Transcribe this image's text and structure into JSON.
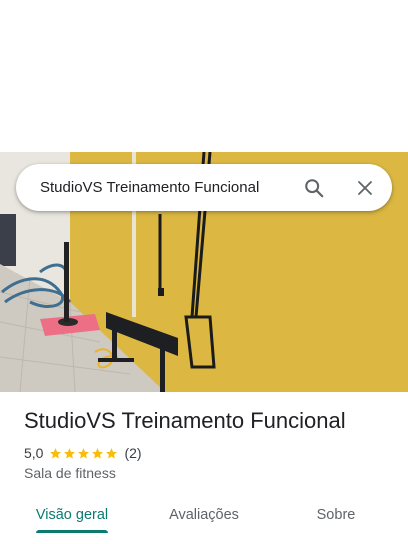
{
  "search": {
    "query": "StudioVS Treinamento Funcional",
    "search_icon": "search-icon",
    "close_icon": "close-icon"
  },
  "place": {
    "name": "StudioVS Treinamento Funcional",
    "rating": "5,0",
    "stars": 5,
    "review_count": "(2)",
    "category": "Sala de fitness"
  },
  "tabs": [
    {
      "label": "Visão geral",
      "active": true
    },
    {
      "label": "Avaliações",
      "active": false
    },
    {
      "label": "Sobre",
      "active": false
    }
  ],
  "colors": {
    "accent": "#0b7a6f",
    "star": "#fbbc04",
    "wall": "#d9b33e"
  }
}
